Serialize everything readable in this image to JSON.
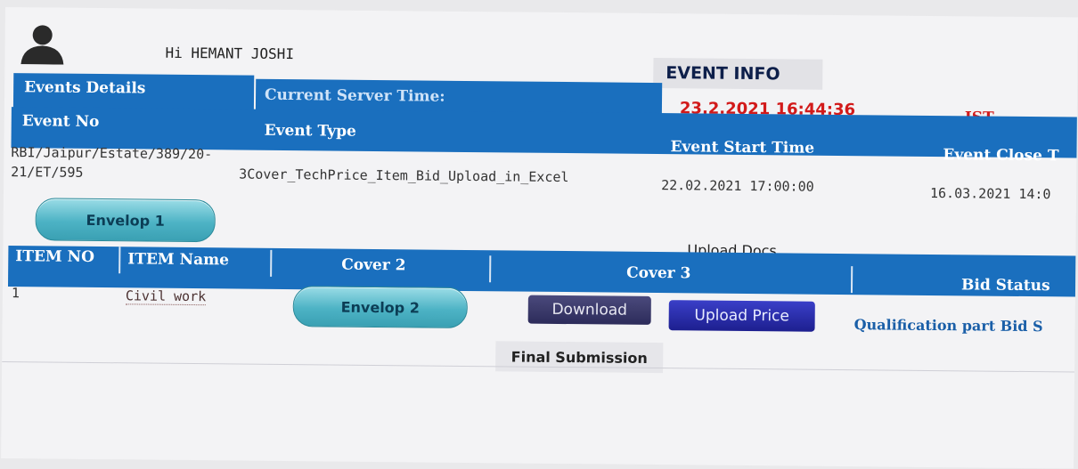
{
  "user": {
    "greeting": "Hi HEMANT JOSHI"
  },
  "title": "EVENT INFO",
  "server": {
    "details_label": "Events Details",
    "time_label": "Current Server Time:",
    "time_value": "23.2.2021 16:44:36",
    "timezone": "IST"
  },
  "event_table": {
    "headers": [
      "Event No",
      "Event Type",
      "Event Start Time",
      "Event Close T"
    ],
    "row": {
      "event_no_line1": "RBI/Jaipur/Estate/389/20-",
      "event_no_line2": "21/ET/595",
      "event_type": "3Cover_TechPrice_Item_Bid_Upload_in_Excel",
      "start_time": "22.02.2021 17:00:00",
      "close_time": "16.03.2021 14:0"
    }
  },
  "envelop1_label": "Envelop 1",
  "upload_docs_label": "Upload Docs",
  "item_table": {
    "headers": [
      "ITEM NO",
      "ITEM Name",
      "Cover 2",
      "Cover 3",
      "Bid Status"
    ],
    "row": {
      "item_no": "1",
      "item_name": "Civil work",
      "envelop2_label": "Envelop 2",
      "download_label": "Download",
      "upload_price_label": "Upload Price",
      "bid_status": "Qualification part Bid S"
    }
  },
  "final_submission_label": "Final Submission",
  "colors": {
    "header_blue": "#1a6fbe",
    "time_red": "#d21a1a",
    "pill_teal": "#4db3c5"
  }
}
